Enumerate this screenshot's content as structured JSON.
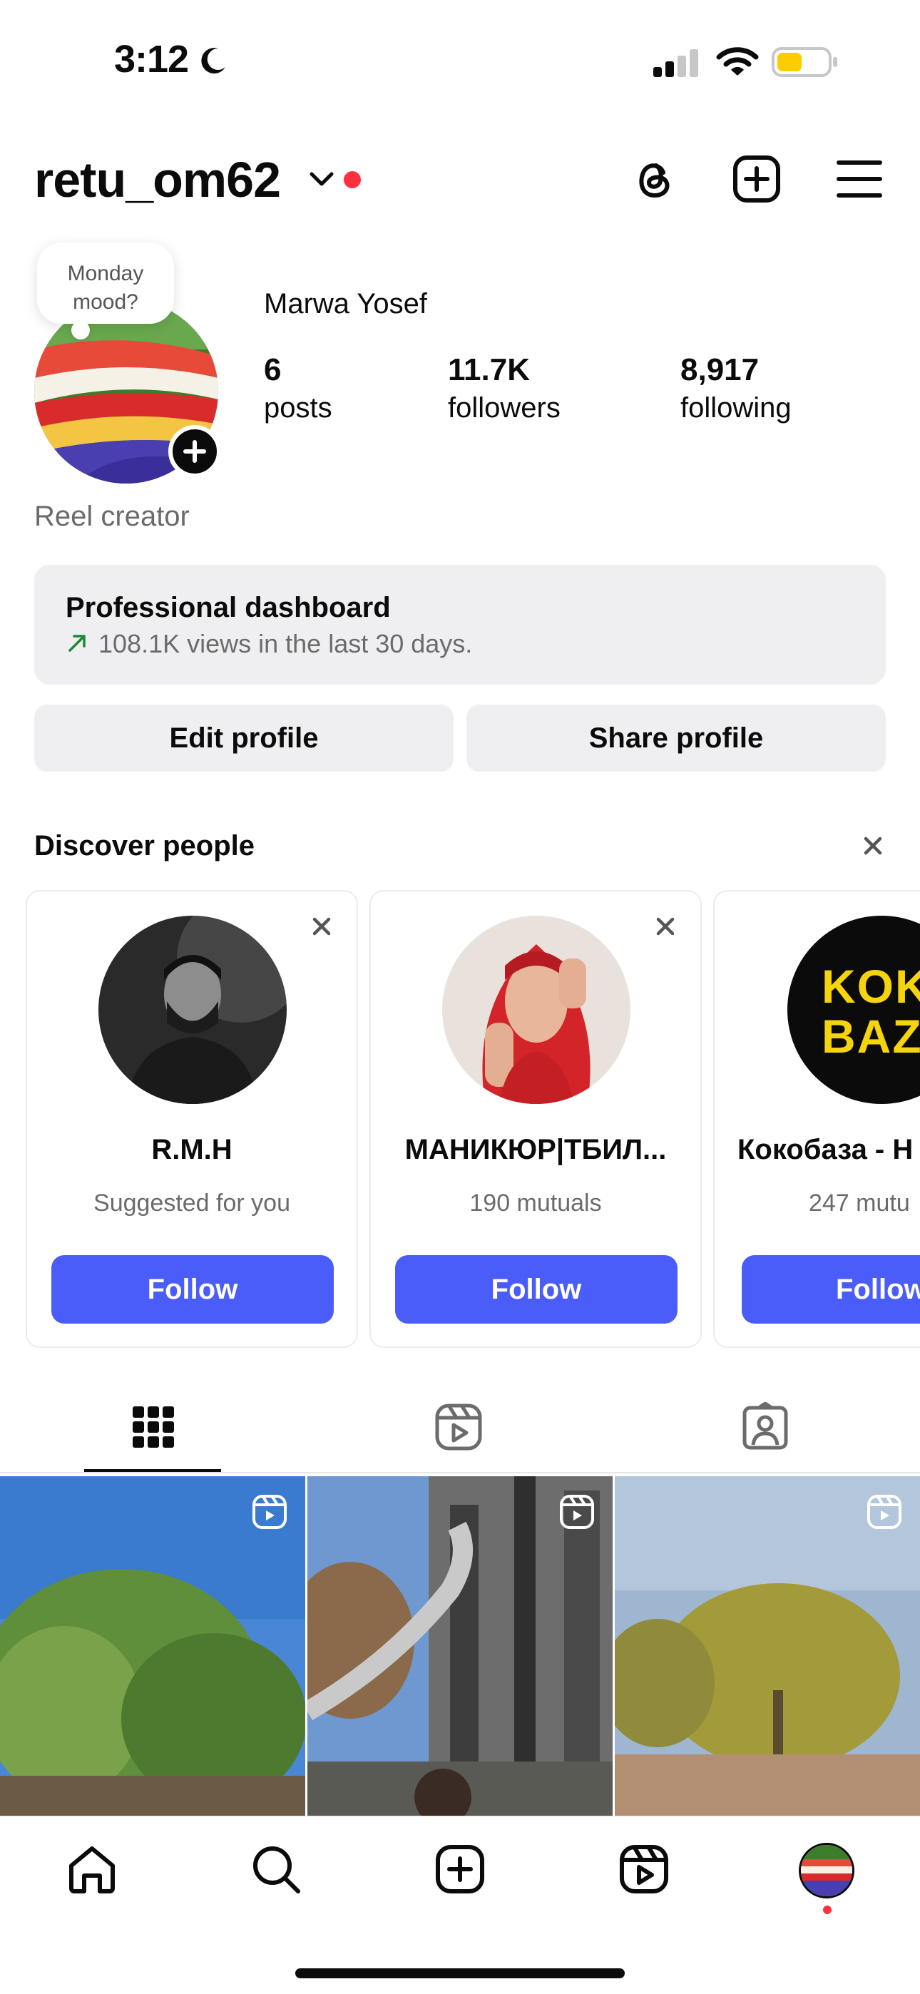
{
  "status_bar": {
    "time": "3:12",
    "icons": [
      "moon-icon",
      "cellular-signal-icon",
      "wifi-icon",
      "battery-icon"
    ],
    "battery_color": "#ffcc00"
  },
  "header": {
    "username": "retu_om62",
    "icons": [
      "chevron-down-icon",
      "threads-icon",
      "create-post-icon",
      "menu-icon"
    ],
    "notification_dot_color": "#ff3040"
  },
  "profile": {
    "note": "Monday mood?",
    "full_name": "Marwa Yosef",
    "stats": [
      {
        "value": "6",
        "label": "posts"
      },
      {
        "value": "11.7K",
        "label": "followers"
      },
      {
        "value": "8,917",
        "label": "following"
      }
    ],
    "bio": "Reel creator"
  },
  "dashboard": {
    "title": "Professional dashboard",
    "subtitle": "108.1K views in the last 30 days."
  },
  "buttons": {
    "edit_profile": "Edit profile",
    "share_profile": "Share profile"
  },
  "discover": {
    "title": "Discover people",
    "cards": [
      {
        "name": "R.M.H",
        "subtitle": "Suggested for you",
        "button": "Follow"
      },
      {
        "name": "МАНИКЮР|ТБИЛ...",
        "subtitle": "190 mutuals",
        "button": "Follow"
      },
      {
        "name": "Кокобаза - Н",
        "subtitle": "247 mutu",
        "button": "Follow",
        "avatar_text": "KOKO BAZA"
      }
    ],
    "follow_color": "#4a5df9"
  },
  "tabs": [
    {
      "name": "grid",
      "icon": "grid-icon",
      "active": true
    },
    {
      "name": "reels",
      "icon": "reels-icon",
      "active": false
    },
    {
      "name": "tagged",
      "icon": "tagged-icon",
      "active": false
    }
  ],
  "bottom_nav": [
    "home-icon",
    "search-icon",
    "create-icon",
    "reels-icon",
    "profile-avatar"
  ]
}
